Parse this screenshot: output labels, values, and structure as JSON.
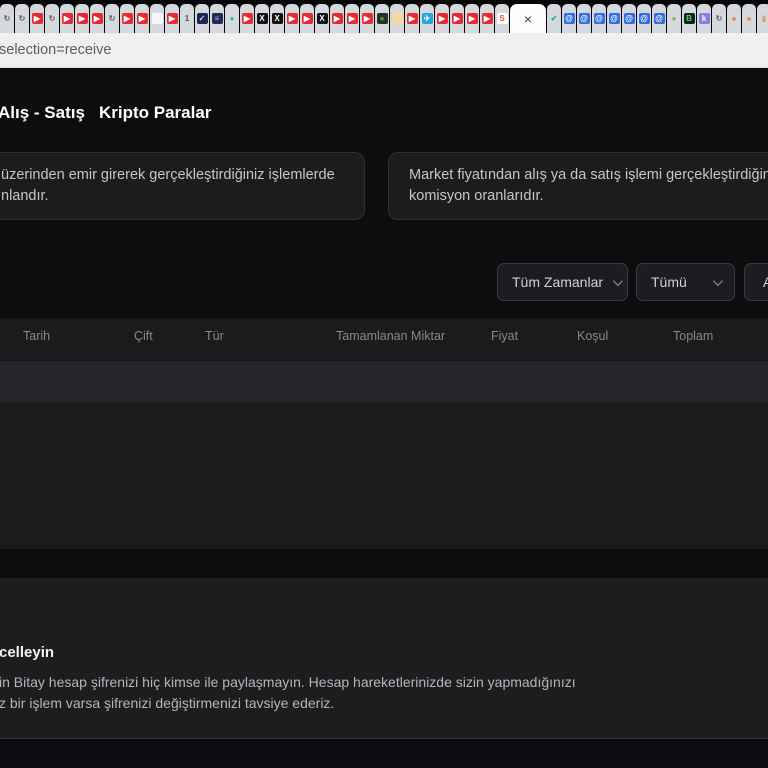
{
  "browser": {
    "url_text": "selection=receive",
    "active_tab_close": "×",
    "icons": {
      "youtube": {
        "name": "youtube-icon",
        "glyph": "▶",
        "bg": "#e62a31",
        "fg": "#ffffff"
      },
      "refresh": {
        "name": "refresh-icon",
        "glyph": "↻",
        "bg": "transparent",
        "fg": "#5f6368"
      },
      "blank": {
        "name": "blank-page-icon",
        "glyph": "",
        "bg": "#f5f6f7",
        "fg": "#9aa0a6"
      },
      "one": {
        "name": "numeral-one-icon",
        "glyph": "1",
        "bg": "transparent",
        "fg": "#51555b"
      },
      "shield-navy": {
        "name": "navy-shield-icon",
        "glyph": "✓",
        "bg": "#1d2650",
        "fg": "#cfd6ff"
      },
      "list-navy": {
        "name": "navy-list-icon",
        "glyph": "≡",
        "bg": "#232a55",
        "fg": "#aeb6e8"
      },
      "teal-dot": {
        "name": "teal-badge-icon",
        "glyph": "●",
        "bg": "transparent",
        "fg": "#35b9a0"
      },
      "x-black": {
        "name": "x-social-icon",
        "glyph": "X",
        "bg": "#111111",
        "fg": "#ffffff"
      },
      "frog": {
        "name": "frog-avatar-icon",
        "glyph": "●",
        "bg": "#253225",
        "fg": "#5c9e44"
      },
      "doc-yellow": {
        "name": "yellow-doc-icon",
        "glyph": "",
        "bg": "#f3d9a2",
        "fg": "#caa154"
      },
      "telegram": {
        "name": "telegram-icon",
        "glyph": "✈",
        "bg": "#2aa4dd",
        "fg": "#ffffff"
      },
      "soundcloud": {
        "name": "soundcloud-icon",
        "glyph": "S",
        "bg": "#ffffff",
        "fg": "#f05b22"
      },
      "check-green": {
        "name": "green-check-icon",
        "glyph": "✔",
        "bg": "transparent",
        "fg": "#1fb978"
      },
      "at-blue": {
        "name": "mail-at-icon",
        "glyph": "@",
        "bg": "#2f6fe3",
        "fg": "#ffffff"
      },
      "robot-green": {
        "name": "green-bot-icon",
        "glyph": "●",
        "bg": "transparent",
        "fg": "#7fb93f"
      },
      "b-green": {
        "name": "green-b-icon",
        "glyph": "B",
        "bg": "#15241a",
        "fg": "#4fd07a"
      },
      "k-purple": {
        "name": "purple-k-icon",
        "glyph": "k",
        "bg": "#8d79e8",
        "fg": "#ffffff"
      },
      "arrow-orange": {
        "name": "orange-arrows-icon",
        "glyph": "»",
        "bg": "transparent",
        "fg": "#e1590f"
      },
      "gold-bar": {
        "name": "gold-bar-icon",
        "glyph": "▮",
        "bg": "transparent",
        "fg": "#c7ad73"
      }
    },
    "tabs_before": [
      "refresh",
      "refresh",
      "youtube",
      "refresh",
      "youtube",
      "youtube",
      "youtube",
      "refresh",
      "youtube",
      "youtube",
      "blank",
      "youtube",
      "one",
      "shield-navy",
      "list-navy",
      "teal-dot",
      "youtube",
      "x-black",
      "x-black",
      "youtube",
      "youtube",
      "x-black",
      "youtube",
      "youtube",
      "youtube",
      "frog",
      "doc-yellow",
      "youtube",
      "telegram",
      "youtube",
      "youtube",
      "youtube",
      "youtube",
      "soundcloud"
    ],
    "tabs_after": [
      "check-green",
      "at-blue",
      "at-blue",
      "at-blue",
      "at-blue",
      "at-blue",
      "at-blue",
      "at-blue",
      "robot-green",
      "b-green",
      "k-purple",
      "refresh",
      "arrow-orange",
      "arrow-orange",
      "gold-bar"
    ]
  },
  "nav": {
    "tabs": [
      {
        "label": "Alış - Satış"
      },
      {
        "label": "Kripto Paralar"
      }
    ]
  },
  "info_cards": [
    {
      "line1": "üzerinden emir girerek gerçekleştirdiğiniz işlemlerde",
      "line2": "nlandır."
    },
    {
      "line1": "Market fiyatından alış ya da satış işlemi gerçekleştirdiğiniz i",
      "line2": "komisyon oranlarıdır."
    }
  ],
  "filters": {
    "time_range": "Tüm Zamanlar",
    "type": "Tümü",
    "third_partial": "Aç"
  },
  "table": {
    "headers": [
      "Tarih",
      "Çift",
      "Tür",
      "Tamamlanan Miktar",
      "Fiyat",
      "Koşul",
      "Toplam"
    ],
    "rows": []
  },
  "security_notice": {
    "heading_partial": "celleyin",
    "line1": "in Bitay hesap şifrenizi hiç kimse ile paylaşmayın. Hesap hareketlerinizde sizin yapmadığınızı",
    "line2": "z bir işlem varsa şifrenizi değiştirmenizi tavsiye ederiz."
  },
  "colors": {
    "page_bg": "#0d0d0f",
    "table_block_bg": "#1b1b1e",
    "row_band_bg": "#26262a",
    "card_bg": "#1c1c1f",
    "section_bg": "#1d1d20",
    "footer_bg": "#0b0c12",
    "urlbar_bg": "#f0f0f1",
    "youtube_red": "#e62a31"
  }
}
